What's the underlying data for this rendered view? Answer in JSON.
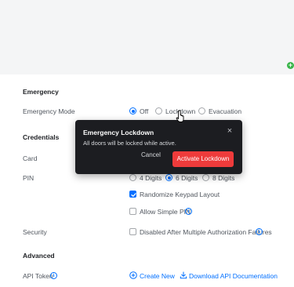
{
  "emergency": {
    "section_title": "Emergency",
    "mode_label": "Emergency Mode",
    "options": [
      "Off",
      "Lockdown",
      "Evacuation"
    ],
    "selected": "Off"
  },
  "credentials": {
    "section_title": "Credentials",
    "card_label": "Card",
    "pin_label": "PIN",
    "pin_options": [
      "4 Digits",
      "6 Digits",
      "8 Digits"
    ],
    "pin_selected": "6 Digits",
    "randomize_label": "Randomize Keypad Layout",
    "randomize_checked": true,
    "simple_pin_label": "Allow Simple PIN",
    "simple_pin_checked": false,
    "security_label": "Security",
    "disabled_after_label": "Disabled After Multiple Authorization Failures",
    "disabled_after_checked": false
  },
  "advanced": {
    "section_title": "Advanced",
    "api_token_label": "API Token",
    "create_new_label": "Create New",
    "download_docs_label": "Download API Documentation"
  },
  "modal": {
    "title": "Emergency Lockdown",
    "message": "All doors will be locked while active.",
    "cancel_label": "Cancel",
    "activate_label": "Activate Lockdown",
    "close_glyph": "×"
  },
  "misc": {
    "add_glyph": "+",
    "info_glyph": "i"
  },
  "colors": {
    "accent": "#006fff",
    "danger": "#ee3b3b",
    "modal_bg": "#1c1d21",
    "success": "#39b54a"
  }
}
